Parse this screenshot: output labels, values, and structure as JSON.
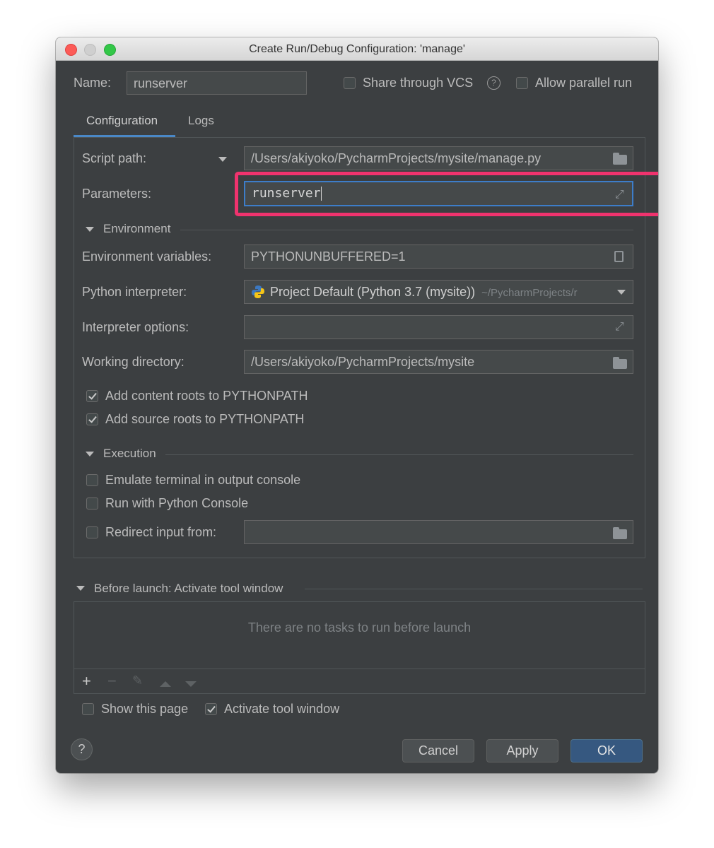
{
  "window": {
    "title": "Create Run/Debug Configuration: 'manage'"
  },
  "header": {
    "name_label": "Name:",
    "name_value": "runserver",
    "share_vcs_label": "Share through VCS",
    "share_vcs_checked": false,
    "allow_parallel_label": "Allow parallel run",
    "allow_parallel_checked": false
  },
  "tabs": [
    {
      "label": "Configuration",
      "active": true
    },
    {
      "label": "Logs",
      "active": false
    }
  ],
  "config": {
    "script_path_label": "Script path:",
    "script_path_value": "/Users/akiyoko/PycharmProjects/mysite/manage.py",
    "parameters_label": "Parameters:",
    "parameters_value": "runserver",
    "environment_section": "Environment",
    "env_vars_label": "Environment variables:",
    "env_vars_value": "PYTHONUNBUFFERED=1",
    "interpreter_label": "Python interpreter:",
    "interpreter_value": "Project Default (Python 3.7 (mysite))",
    "interpreter_path": "~/PycharmProjects/r",
    "interp_options_label": "Interpreter options:",
    "interp_options_value": "",
    "working_dir_label": "Working directory:",
    "working_dir_value": "/Users/akiyoko/PycharmProjects/mysite",
    "add_content_roots_label": "Add content roots to PYTHONPATH",
    "add_content_roots_checked": true,
    "add_source_roots_label": "Add source roots to PYTHONPATH",
    "add_source_roots_checked": true,
    "execution_section": "Execution",
    "emulate_terminal_label": "Emulate terminal in output console",
    "emulate_terminal_checked": false,
    "python_console_label": "Run with Python Console",
    "python_console_checked": false,
    "redirect_input_label": "Redirect input from:",
    "redirect_input_checked": false,
    "redirect_input_value": ""
  },
  "before_launch": {
    "section_label": "Before launch: Activate tool window",
    "empty_text": "There are no tasks to run before launch",
    "show_page_label": "Show this page",
    "show_page_checked": false,
    "activate_tool_label": "Activate tool window",
    "activate_tool_checked": true
  },
  "footer": {
    "help_label": "?",
    "cancel_label": "Cancel",
    "apply_label": "Apply",
    "ok_label": "OK"
  },
  "colors": {
    "dialog_bg": "#3c3f41",
    "field_bg": "#45494a",
    "accent": "#3d7dc9",
    "highlight": "#f0336e",
    "ok_button": "#365880"
  }
}
